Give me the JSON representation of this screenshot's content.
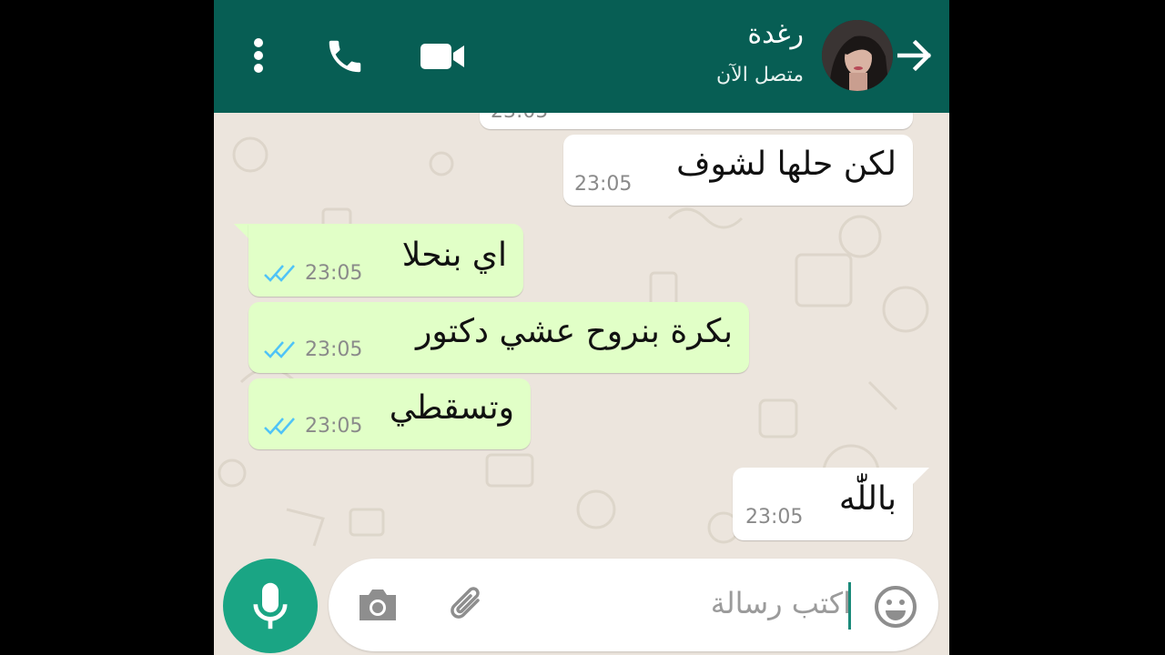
{
  "colors": {
    "header": "#075e54",
    "incoming_bubble": "#ffffff",
    "outgoing_bubble": "#e1ffc7",
    "accent": "#1aa584",
    "read_ticks": "#4fc3f7"
  },
  "header": {
    "contact_name": "رغدة",
    "status": "متصل الآن",
    "icons": [
      "more-vert-icon",
      "phone-icon",
      "video-camera-icon",
      "arrow-right-icon"
    ]
  },
  "messages": [
    {
      "text": "",
      "time": "23:05",
      "direction": "incoming"
    },
    {
      "text": "لكن حلها لشوف",
      "time": "23:05",
      "direction": "incoming"
    },
    {
      "text": "اي بنحلا",
      "time": "23:05",
      "direction": "outgoing",
      "status": "read"
    },
    {
      "text": "بكرة بنروح عشي دكتور",
      "time": "23:05",
      "direction": "outgoing",
      "status": "read"
    },
    {
      "text": "وتسقطي",
      "time": "23:05",
      "direction": "outgoing",
      "status": "read"
    },
    {
      "text": "باللّٰه",
      "time": "23:05",
      "direction": "incoming"
    }
  ],
  "composer": {
    "placeholder": "اكتب رسالة",
    "icons": [
      "emoji-icon",
      "attach-icon",
      "camera-icon",
      "mic-icon"
    ]
  }
}
